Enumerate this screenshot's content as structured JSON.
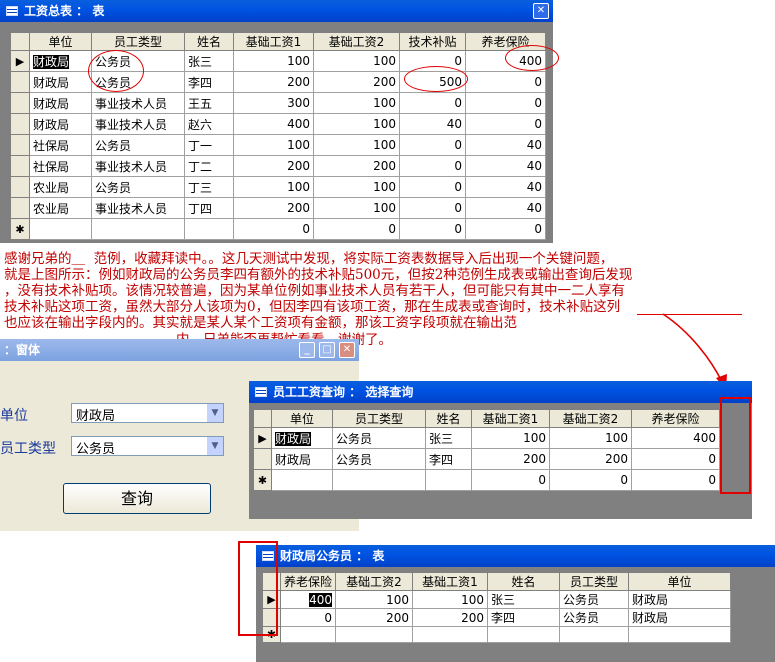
{
  "window1": {
    "title": "工资总表 ： 表",
    "columns": [
      "单位",
      "员工类型",
      "姓名",
      "基础工资1",
      "基础工资2",
      "技术补贴",
      "养老保险"
    ],
    "rows": [
      [
        "财政局",
        "公务员",
        "张三",
        "100",
        "100",
        "0",
        "400"
      ],
      [
        "财政局",
        "公务员",
        "李四",
        "200",
        "200",
        "500",
        "0"
      ],
      [
        "财政局",
        "事业技术人员",
        "王五",
        "300",
        "100",
        "0",
        "0"
      ],
      [
        "财政局",
        "事业技术人员",
        "赵六",
        "400",
        "100",
        "40",
        "0"
      ],
      [
        "社保局",
        "公务员",
        "丁一",
        "100",
        "100",
        "0",
        "40"
      ],
      [
        "社保局",
        "事业技术人员",
        "丁二",
        "200",
        "200",
        "0",
        "40"
      ],
      [
        "农业局",
        "公务员",
        "丁三",
        "100",
        "100",
        "0",
        "40"
      ],
      [
        "农业局",
        "事业技术人员",
        "丁四",
        "200",
        "100",
        "0",
        "40"
      ]
    ],
    "new_row": [
      "",
      "",
      "",
      "0",
      "0",
      "0",
      "0"
    ],
    "row_selector_current": "▶",
    "row_selector_new": "✱"
  },
  "note": {
    "line1": "感谢兄弟的＿  范例，收藏拜读中。。这几天测试中发现，将实际工资表数据导入后出现一个关键问题，",
    "line2": "就是上图所示：例如财政局的公务员李四有额外的技术补贴500元，但按2种范例生成表或输出查询后发现",
    "line3": "，没有技术补贴项。该情况较普遍，因为某单位例如事业技术人员有若干人，但可能只有其中一二人享有",
    "line4": "技术补贴这项工资，虽然大部分人该项为0，但因李四有该项工资，那在生成表或查询时，技术补贴这列",
    "line5": "也应该在输出字段内的。其实就是某人某个工资项有金额，那该工资字段项就在输出范",
    "line6": "内。兄弟能否再帮忙看看，谢谢了。"
  },
  "form": {
    "title": "：窗体",
    "unit_label": "单位",
    "unit_value": "财政局",
    "type_label": "员工类型",
    "type_value": "公务员",
    "query_button": "查询"
  },
  "window2": {
    "title": "员工工资查询 ： 选择查询",
    "columns": [
      "单位",
      "员工类型",
      "姓名",
      "基础工资1",
      "基础工资2",
      "养老保险"
    ],
    "rows": [
      [
        "财政局",
        "公务员",
        "张三",
        "100",
        "100",
        "400"
      ],
      [
        "财政局",
        "公务员",
        "李四",
        "200",
        "200",
        "0"
      ]
    ],
    "new_row": [
      "",
      "",
      "",
      "0",
      "0",
      "0"
    ]
  },
  "window3": {
    "title": "财政局公务员 ： 表",
    "columns": [
      "养老保险",
      "基础工资2",
      "基础工资1",
      "姓名",
      "员工类型",
      "单位"
    ],
    "rows": [
      [
        "400",
        "100",
        "100",
        "张三",
        "公务员",
        "财政局"
      ],
      [
        "0",
        "200",
        "200",
        "李四",
        "公务员",
        "财政局"
      ]
    ]
  },
  "colors": {
    "titlebar": "#0054e3",
    "annotation": "#e00000",
    "grid_header": "#ece9d8"
  }
}
